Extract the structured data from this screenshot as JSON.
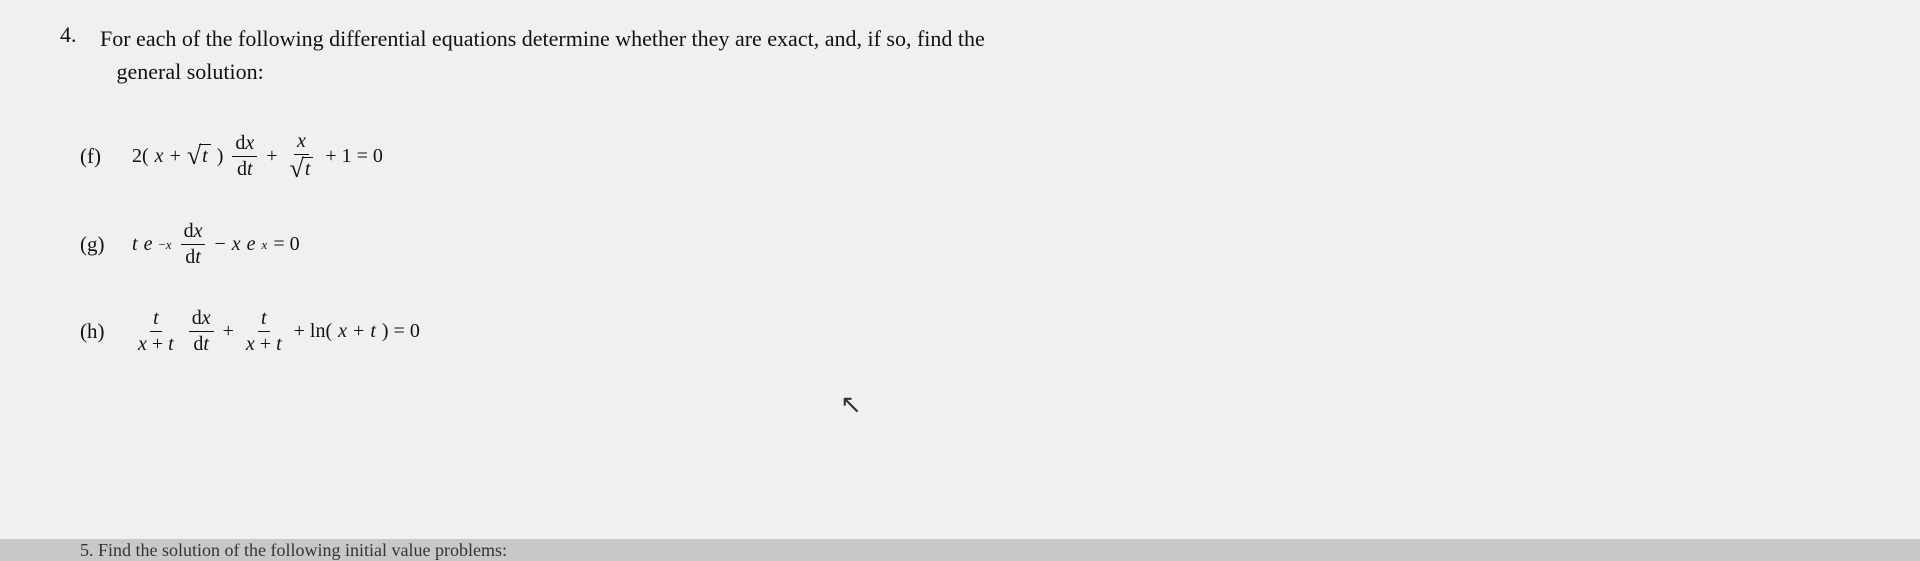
{
  "question": {
    "number": "4.",
    "intro_line1": "For each of the following differential equations determine whether they are exact, and, if so, find the",
    "intro_line2": "general solution:",
    "parts": [
      {
        "label": "(f)",
        "html_id": "part-f"
      },
      {
        "label": "(g)",
        "html_id": "part-g"
      },
      {
        "label": "(h)",
        "html_id": "part-h"
      }
    ],
    "bottom_text": "5.  Find the solution of the following initial value problems:"
  }
}
